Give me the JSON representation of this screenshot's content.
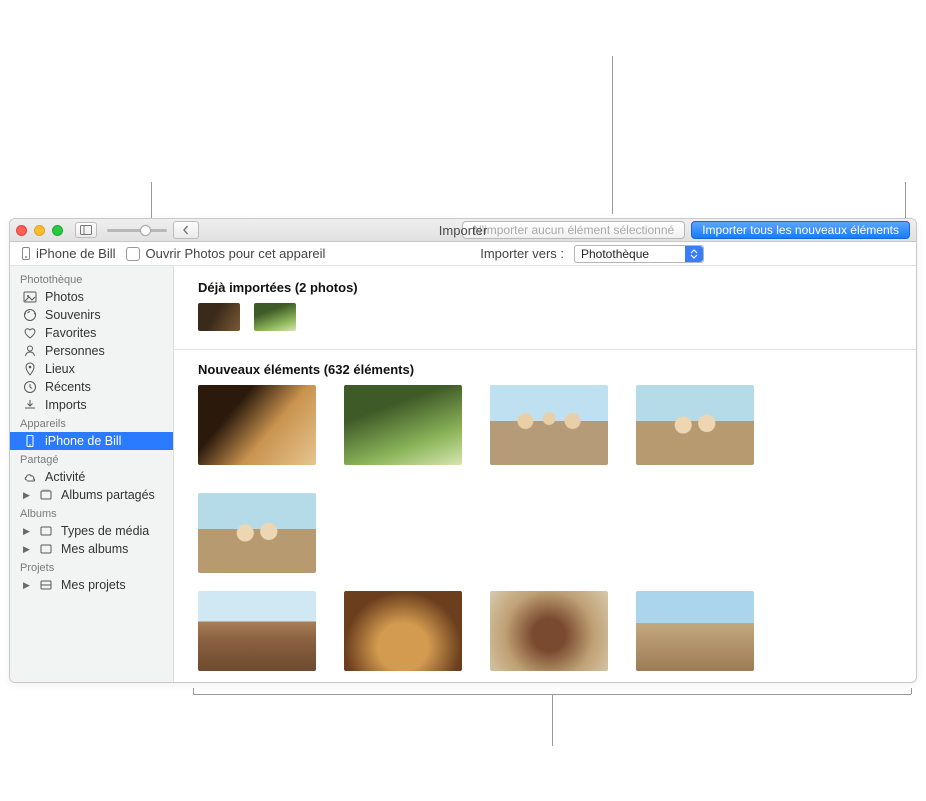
{
  "window": {
    "title": "Importer"
  },
  "toolbar": {
    "import_none_selected": "N'importer aucun élément sélectionné",
    "import_all_new": "Importer tous les nouveaux éléments"
  },
  "zoom": {
    "percent": 68
  },
  "subbar": {
    "device_name": "iPhone de Bill",
    "open_on_connect_label": "Ouvrir Photos pour cet appareil",
    "open_on_connect_checked": false,
    "import_to_label": "Importer vers :",
    "import_to_selected": "Photothèque"
  },
  "sidebar": {
    "sections": [
      {
        "title": "Photothèque",
        "items": [
          {
            "label": "Photos",
            "icon": "photos",
            "selected": false
          },
          {
            "label": "Souvenirs",
            "icon": "souvenirs",
            "selected": false
          },
          {
            "label": "Favorites",
            "icon": "heart",
            "selected": false
          },
          {
            "label": "Personnes",
            "icon": "person",
            "selected": false
          },
          {
            "label": "Lieux",
            "icon": "pin",
            "selected": false
          },
          {
            "label": "Récents",
            "icon": "clock",
            "selected": false
          },
          {
            "label": "Imports",
            "icon": "import",
            "selected": false
          }
        ]
      },
      {
        "title": "Appareils",
        "items": [
          {
            "label": "iPhone de Bill",
            "icon": "phone",
            "selected": true
          }
        ]
      },
      {
        "title": "Partagé",
        "items": [
          {
            "label": "Activité",
            "icon": "cloud",
            "selected": false
          },
          {
            "label": "Albums partagés",
            "icon": "album",
            "disclosure": true,
            "selected": false
          }
        ]
      },
      {
        "title": "Albums",
        "items": [
          {
            "label": "Types de média",
            "icon": "album",
            "disclosure": true,
            "selected": false
          },
          {
            "label": "Mes albums",
            "icon": "album",
            "disclosure": true,
            "selected": false
          }
        ]
      },
      {
        "title": "Projets",
        "items": [
          {
            "label": "Mes projets",
            "icon": "project",
            "disclosure": true,
            "selected": false
          }
        ]
      }
    ]
  },
  "content": {
    "already": {
      "title": "Déjà importées (2 photos)",
      "count": 2
    },
    "new": {
      "title": "Nouveaux éléments (632 éléments)",
      "count": 632
    }
  },
  "colors": {
    "accent": "#2a7bff",
    "button_primary_top": "#5aa6ff",
    "button_primary_bottom": "#1a7bff"
  }
}
